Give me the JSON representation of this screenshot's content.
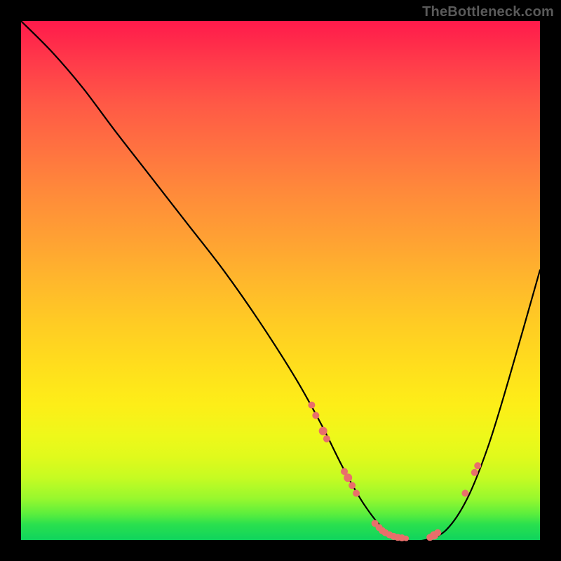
{
  "watermark": "TheBottleneck.com",
  "chart_data": {
    "type": "line",
    "title": "",
    "xlabel": "",
    "ylabel": "",
    "xlim": [
      0,
      100
    ],
    "ylim": [
      0,
      100
    ],
    "series": [
      {
        "name": "bottleneck-curve",
        "x": [
          0,
          6,
          12,
          18,
          25,
          32,
          39,
          46,
          53,
          58,
          62,
          66,
          70,
          74,
          78,
          82,
          86,
          90,
          94,
          100
        ],
        "y": [
          100,
          94,
          87,
          79,
          70,
          61,
          52,
          42,
          31,
          22,
          14,
          7,
          2,
          0,
          0,
          2,
          8,
          18,
          31,
          52
        ]
      }
    ],
    "markers": {
      "name": "highlighted-points",
      "color": "#e96f6b",
      "points": [
        {
          "x": 56,
          "y": 26,
          "r": 5
        },
        {
          "x": 56.8,
          "y": 24,
          "r": 5
        },
        {
          "x": 58.2,
          "y": 21,
          "r": 6
        },
        {
          "x": 58.9,
          "y": 19.5,
          "r": 5
        },
        {
          "x": 62.3,
          "y": 13.2,
          "r": 5
        },
        {
          "x": 63,
          "y": 12,
          "r": 6
        },
        {
          "x": 63.8,
          "y": 10.5,
          "r": 5
        },
        {
          "x": 64.6,
          "y": 9,
          "r": 5
        },
        {
          "x": 68.2,
          "y": 3.2,
          "r": 5
        },
        {
          "x": 69,
          "y": 2.4,
          "r": 5
        },
        {
          "x": 69.6,
          "y": 1.8,
          "r": 5
        },
        {
          "x": 70.2,
          "y": 1.4,
          "r": 5
        },
        {
          "x": 71,
          "y": 1,
          "r": 5
        },
        {
          "x": 71.8,
          "y": 0.7,
          "r": 5
        },
        {
          "x": 72.6,
          "y": 0.5,
          "r": 5
        },
        {
          "x": 73.4,
          "y": 0.4,
          "r": 5
        },
        {
          "x": 74.2,
          "y": 0.3,
          "r": 4
        },
        {
          "x": 78.8,
          "y": 0.5,
          "r": 5
        },
        {
          "x": 79.6,
          "y": 0.9,
          "r": 6
        },
        {
          "x": 80.3,
          "y": 1.4,
          "r": 5
        },
        {
          "x": 85.6,
          "y": 9,
          "r": 5
        },
        {
          "x": 87.4,
          "y": 13,
          "r": 5
        },
        {
          "x": 88,
          "y": 14.3,
          "r": 5
        }
      ]
    }
  }
}
